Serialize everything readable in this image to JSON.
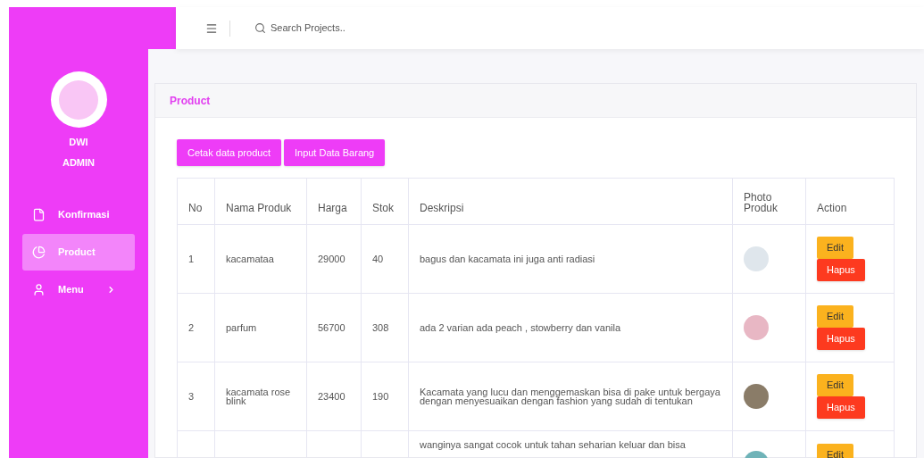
{
  "header": {
    "search": {
      "placeholder": "Search Projects.."
    }
  },
  "sidebar": {
    "user": {
      "name": "DWI",
      "role": "ADMIN"
    },
    "items": [
      {
        "label": "Konfirmasi",
        "kind": "document",
        "selected": false,
        "has_submenu": false
      },
      {
        "label": "Product",
        "kind": "chart",
        "selected": true,
        "has_submenu": false
      },
      {
        "label": "Menu",
        "kind": "person",
        "selected": false,
        "has_submenu": true
      }
    ]
  },
  "card": {
    "title": "Product",
    "buttons": [
      "Cetak data product",
      "Input Data Barang"
    ],
    "table": {
      "columns": [
        "No",
        "Nama Produk",
        "Harga",
        "Stok",
        "Deskripsi",
        "Photo Produk",
        "Action"
      ],
      "rows": [
        {
          "no": "1",
          "name": "kacamataa",
          "price": "29000",
          "stock": "40",
          "description": "bagus dan kacamata ini juga anti radiasi",
          "actions": [
            "Edit",
            "Hapus"
          ]
        },
        {
          "no": "2",
          "name": "parfum",
          "price": "56700",
          "stock": "308",
          "description": "ada 2 varian ada peach , stowberry dan vanila",
          "actions": [
            "Edit",
            "Hapus"
          ]
        },
        {
          "no": "3",
          "name": "kacamata rose blink",
          "price": "23400",
          "stock": "190",
          "description": "Kacamata yang lucu dan menggemaskan bisa di pake untuk bergaya dengan menyesuaikan dengan fashion yang sudah di tentukan",
          "actions": [
            "Edit",
            "Hapus"
          ]
        },
        {
          "description": "wanginya sangat cocok untuk tahan seharian keluar dan bisa",
          "actions": [
            "Edit"
          ]
        }
      ]
    }
  }
}
